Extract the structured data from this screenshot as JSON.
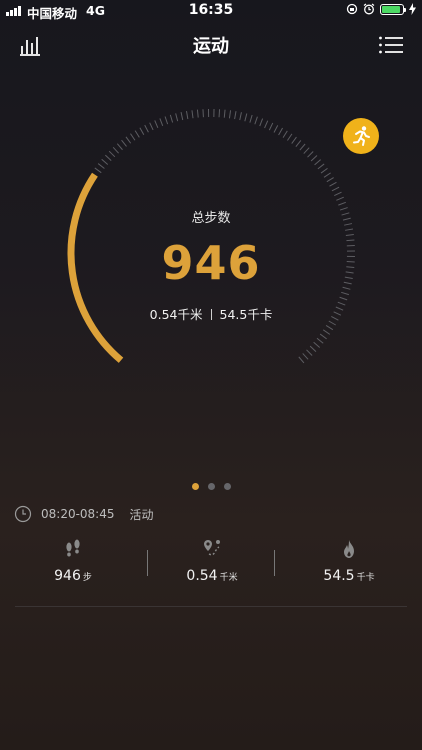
{
  "status_bar": {
    "carrier": "中国移动",
    "network": "4G",
    "time": "16:35",
    "battery_level": 0.9,
    "icons": [
      "signal-icon",
      "lock-rotation-icon",
      "alarm-icon",
      "battery-icon",
      "charging-icon"
    ]
  },
  "nav": {
    "title": "运动",
    "left_icon": "bar-chart-icon",
    "right_icon": "menu-list-icon"
  },
  "gauge": {
    "label": "总步数",
    "steps": "946",
    "distance": "0.54千米",
    "calories": "54.5千卡",
    "progress": 0.3,
    "accent": "#dda23a",
    "badge_icon": "running-icon",
    "badge_color": "#f0b21a"
  },
  "pager": {
    "count": 3,
    "active": 0
  },
  "activity": {
    "time_range": "08:20-08:45",
    "type": "活动",
    "stats": [
      {
        "icon": "footprints-icon",
        "value": "946",
        "unit": "步"
      },
      {
        "icon": "route-icon",
        "value": "0.54",
        "unit": "千米"
      },
      {
        "icon": "flame-icon",
        "value": "54.5",
        "unit": "千卡"
      }
    ]
  }
}
